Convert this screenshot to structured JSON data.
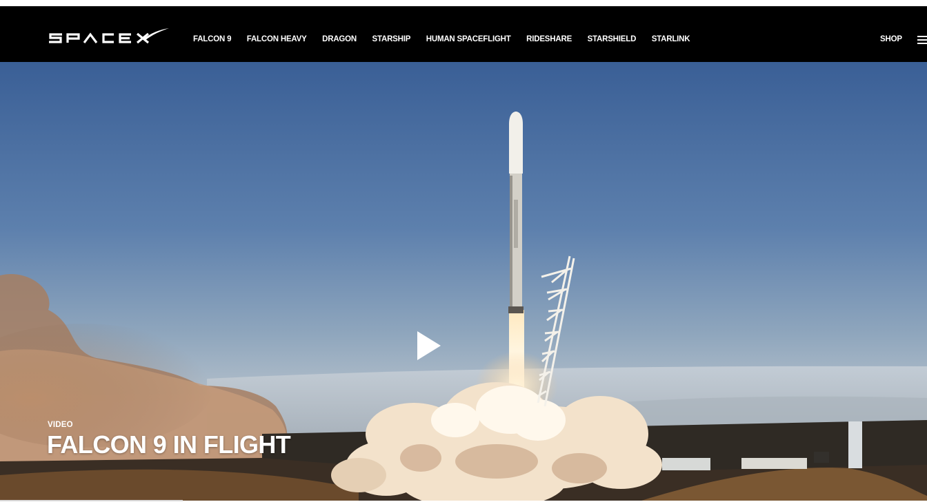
{
  "header": {
    "logo_text": "SPACEX",
    "nav_items": [
      {
        "label": "FALCON 9"
      },
      {
        "label": "FALCON HEAVY"
      },
      {
        "label": "DRAGON"
      },
      {
        "label": "STARSHIP"
      },
      {
        "label": "HUMAN SPACEFLIGHT"
      },
      {
        "label": "RIDESHARE"
      },
      {
        "label": "STARSHIELD"
      },
      {
        "label": "STARLINK"
      }
    ],
    "shop_label": "SHOP",
    "menu_icon": "hamburger-menu-icon"
  },
  "hero": {
    "media_type": "video",
    "play_icon": "play-icon",
    "label": "VIDEO",
    "title": "FALCON 9 IN FLIGHT",
    "colors": {
      "sky_top": "#3a5f96",
      "sky_horizon": "#a9b7c4",
      "smoke": "#f0dcc4",
      "ground": "#2c241c"
    }
  }
}
